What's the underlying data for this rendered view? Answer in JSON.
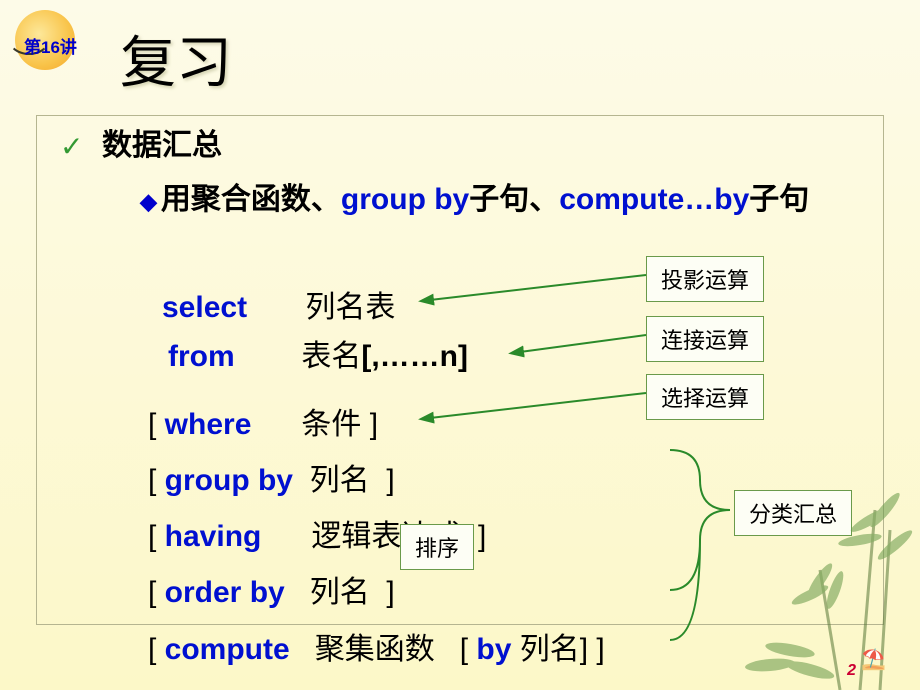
{
  "badge": {
    "label": "第16讲"
  },
  "title": "复习",
  "heading": "数据汇总",
  "sub": {
    "prefix_black": "用聚合函数、",
    "kw1": "group  by",
    "mid1": "子句、",
    "kw2": "compute…by",
    "tail": "子句"
  },
  "sql": {
    "select": {
      "kw": "select",
      "rest": "       列名表"
    },
    "from": {
      "kw": "from",
      "rest": "        表名",
      "bold": "[,……n]"
    },
    "where": {
      "open": "[ ",
      "kw": "where",
      "rest": "      条件 ]"
    },
    "group": {
      "open": "[ ",
      "kw": "group   by",
      "rest": "  列名  ]"
    },
    "having": {
      "open": "[ ",
      "kw": "having",
      "rest": "      逻辑表达式  ]"
    },
    "order": {
      "open": "[ ",
      "kw": "order   by",
      "rest": "   列名  ]"
    },
    "compute": {
      "open": "[ ",
      "kw": "compute",
      "mid": "   聚集函数   [ ",
      "kw2": "by",
      "tail": " 列名]  ]"
    }
  },
  "annots": {
    "proj": "投影运算",
    "join": "连接运算",
    "sel": "选择运算",
    "agg": "分类汇总",
    "sort": "排序"
  },
  "page": "2"
}
